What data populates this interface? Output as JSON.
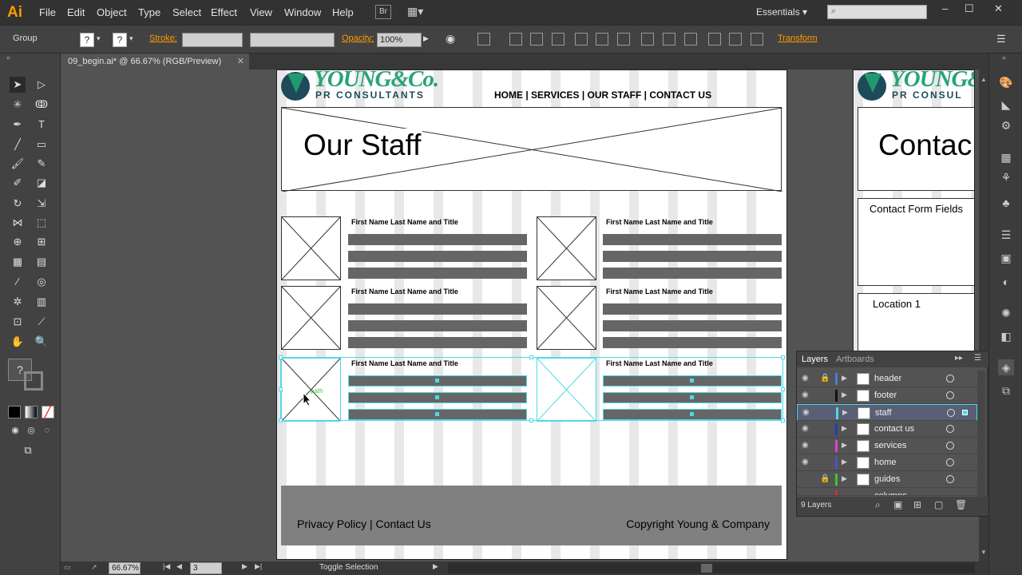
{
  "app": {
    "logo": "Ai"
  },
  "menu": [
    "File",
    "Edit",
    "Object",
    "Type",
    "Select",
    "Effect",
    "View",
    "Window",
    "Help"
  ],
  "menubar": {
    "bridge": "Br",
    "workspace": "Essentials"
  },
  "control": {
    "selection_label": "Group",
    "stroke_label": "Stroke:",
    "opacity_label": "Opacity:",
    "opacity_value": "100%",
    "transform_label": "Transform"
  },
  "document_tab": {
    "title": "09_begin.ai* @ 66.67% (RGB/Preview)"
  },
  "artboard1": {
    "logo_main": "YOUNG&Co.",
    "logo_sub": "PR CONSULTANTS",
    "nav": "HOME | SERVICES  | OUR STAFF | CONTACT US",
    "hero_title": "Our Staff",
    "staff_titles": [
      "First Name Last Name and Title",
      "First Name Last Name and Title",
      "First Name Last Name and Title",
      "First Name Last Name and Title",
      "First Name Last Name and Title",
      "First Name Last Name and Title"
    ],
    "path_label": "path",
    "footer_left": "Privacy Policy |  Contact Us",
    "footer_right": "Copyright Young & Company"
  },
  "artboard2": {
    "logo_main": "YOUNG&Co",
    "logo_sub": "PR CONSUL",
    "hero_title": "Contac",
    "box1": "Contact Form Fields",
    "box2": "Location 1"
  },
  "layers_panel": {
    "tabs": [
      "Layers",
      "Artboards"
    ],
    "layers": [
      {
        "name": "header",
        "color": "#4a7bd4"
      },
      {
        "name": "footer",
        "color": "#222222"
      },
      {
        "name": "staff",
        "color": "#4fd9e6"
      },
      {
        "name": "contact us",
        "color": "#1f3fb0"
      },
      {
        "name": "services",
        "color": "#d447d4"
      },
      {
        "name": "home",
        "color": "#5050d0"
      },
      {
        "name": "guides",
        "color": "#40c040"
      },
      {
        "name": "columns",
        "color": "#d43030"
      }
    ],
    "count": "9 Layers"
  },
  "status": {
    "zoom": "66.67%",
    "page": "3",
    "tool": "Toggle Selection"
  }
}
